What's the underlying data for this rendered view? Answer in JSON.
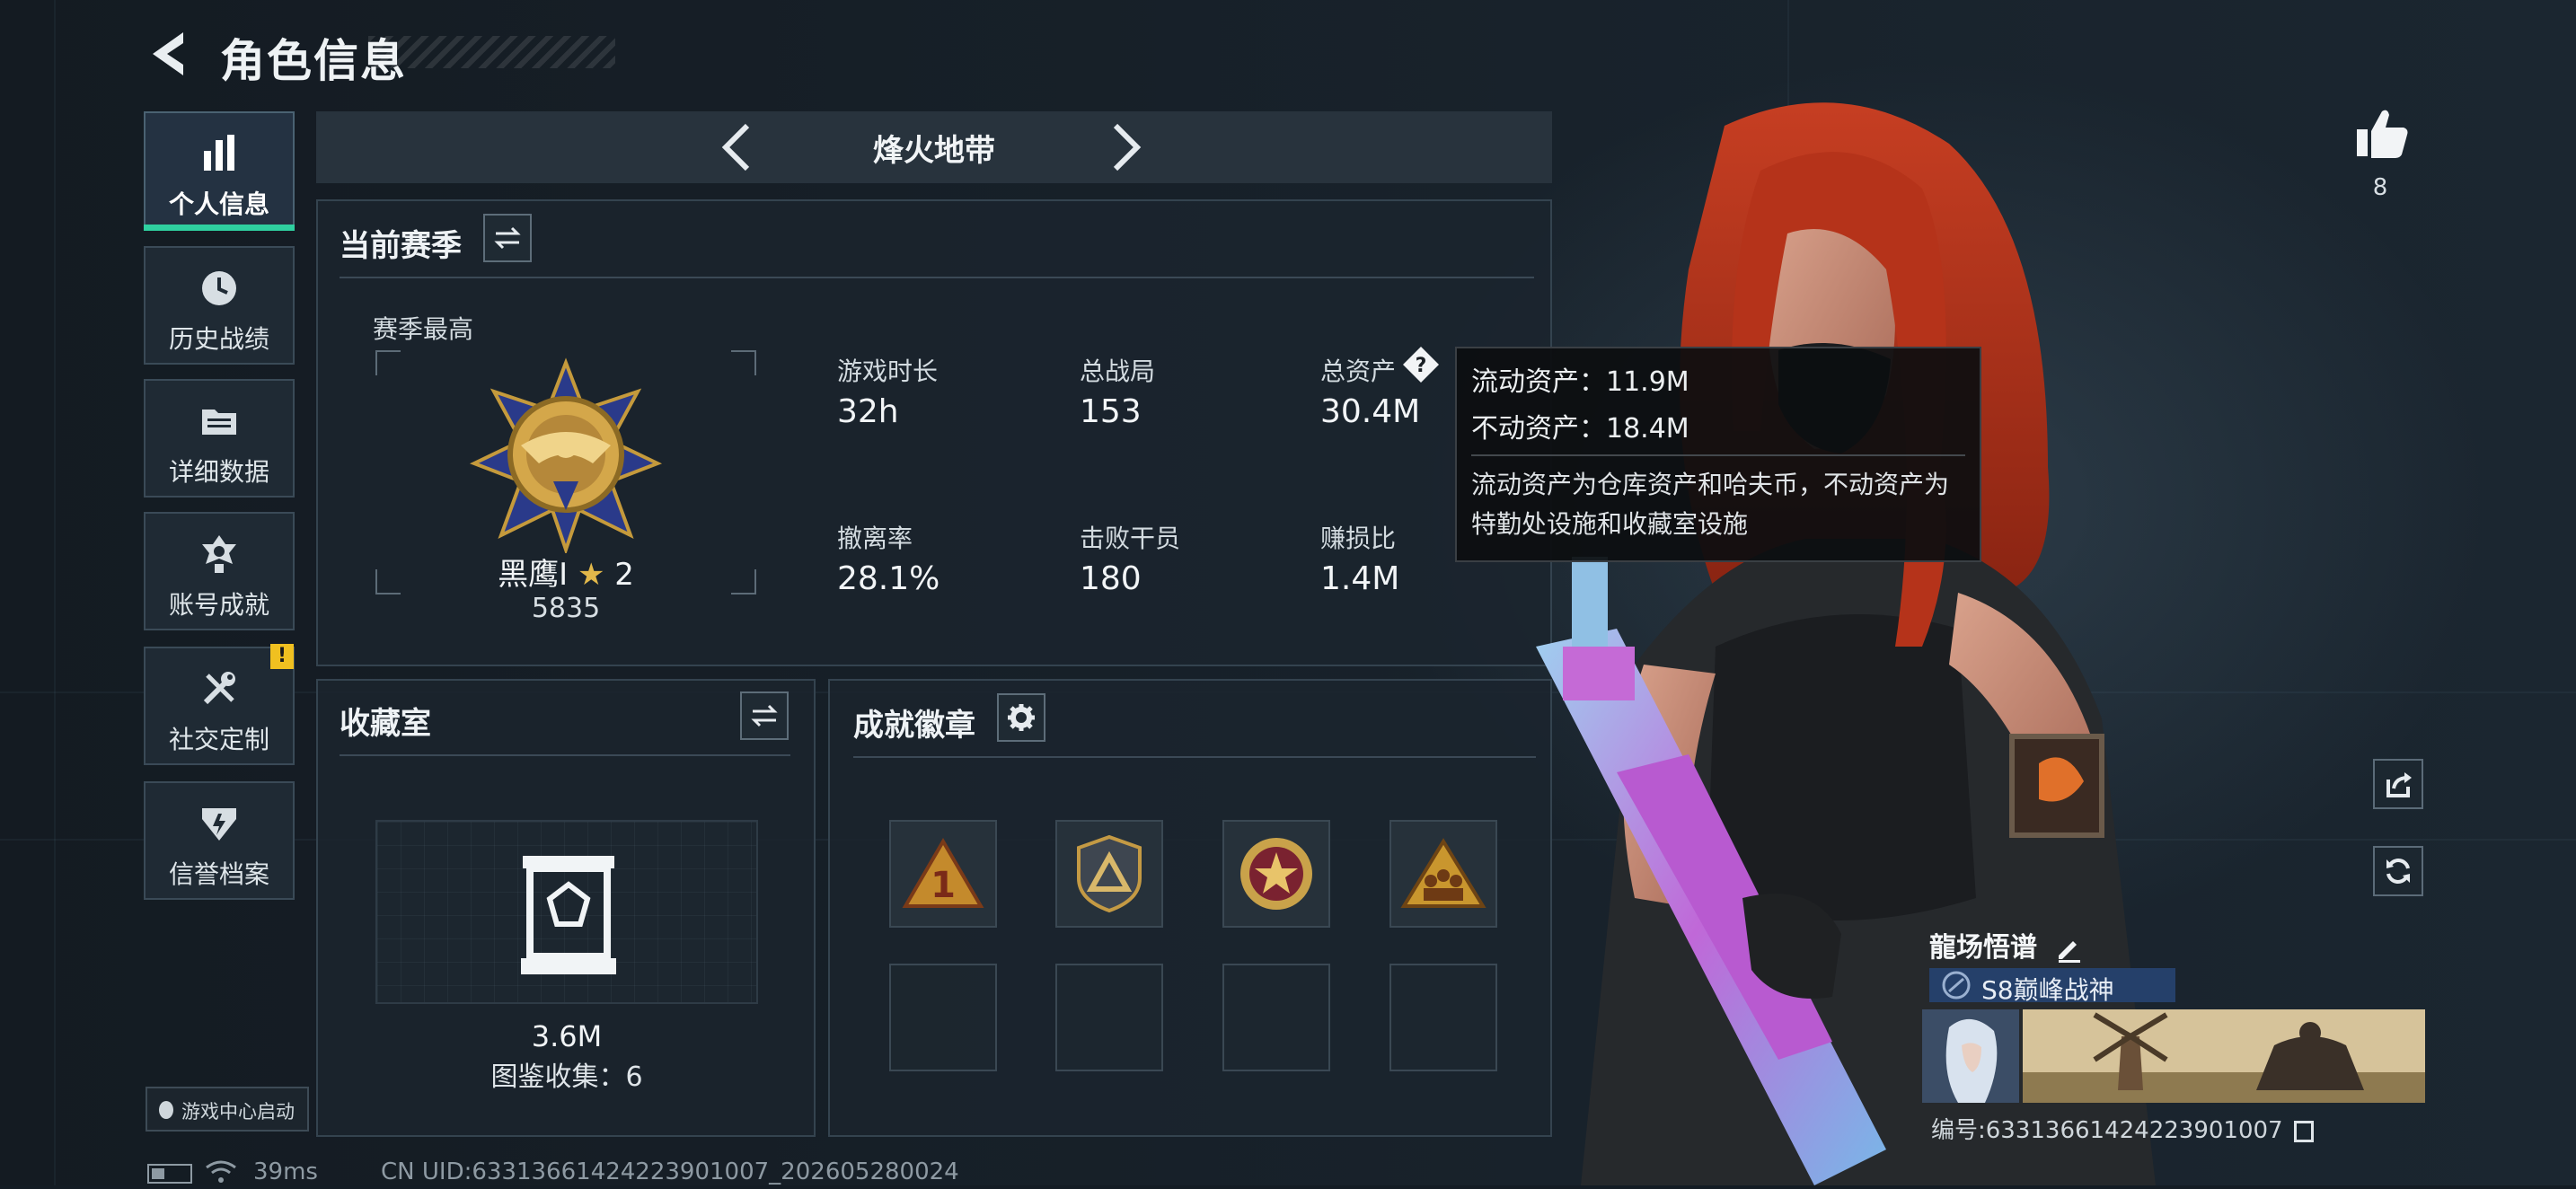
{
  "header": {
    "title": "角色信息"
  },
  "nav": {
    "items": [
      {
        "label": "个人信息",
        "icon": "bar-chart-icon",
        "active": true
      },
      {
        "label": "历史战绩",
        "icon": "history-icon"
      },
      {
        "label": "详细数据",
        "icon": "folder-icon"
      },
      {
        "label": "账号成就",
        "icon": "medal-icon"
      },
      {
        "label": "社交定制",
        "icon": "tools-icon",
        "badge": "!"
      },
      {
        "label": "信誉档案",
        "icon": "credit-icon"
      }
    ]
  },
  "mode": {
    "title": "烽火地带"
  },
  "season": {
    "title": "当前赛季",
    "best_label": "赛季最高",
    "rank_name": "黑鹰I",
    "rank_stars": "2",
    "rank_score": "5835",
    "stats": [
      {
        "label": "游戏时长",
        "value": "32h"
      },
      {
        "label": "总战局",
        "value": "153"
      },
      {
        "label": "总资产",
        "value": "30.4M"
      },
      {
        "label": "撤离率",
        "value": "28.1%"
      },
      {
        "label": "击败干员",
        "value": "180"
      },
      {
        "label": "赚损比",
        "value": "1.4M"
      }
    ]
  },
  "tooltip": {
    "line1": "流动资产：11.9M",
    "line2": "不动资产：18.4M",
    "desc": "流动资产为仓库资产和哈夫币，不动资产为特勤处设施和收藏室设施"
  },
  "collection": {
    "title": "收藏室",
    "value": "3.6M",
    "count": "图鉴收集：6"
  },
  "achievements": {
    "title": "成就徽章",
    "badges": [
      "rank-1-badge-icon",
      "triangle-shield-badge-icon",
      "star-wreath-badge-icon",
      "squad-triangle-badge-icon"
    ]
  },
  "player": {
    "likes": "8",
    "name": "龍场悟谱",
    "title_badge": "S8巅峰战神",
    "id": "编号:6331366142422390100​7"
  },
  "footer": {
    "game_center": "游戏中心启动",
    "ping": "39ms",
    "uid": "CN UID:6331366142422390100​7_202605280024"
  },
  "colors": {
    "accent": "#2fd0a0",
    "panel": "#1b252e",
    "warning": "#f0c020"
  }
}
